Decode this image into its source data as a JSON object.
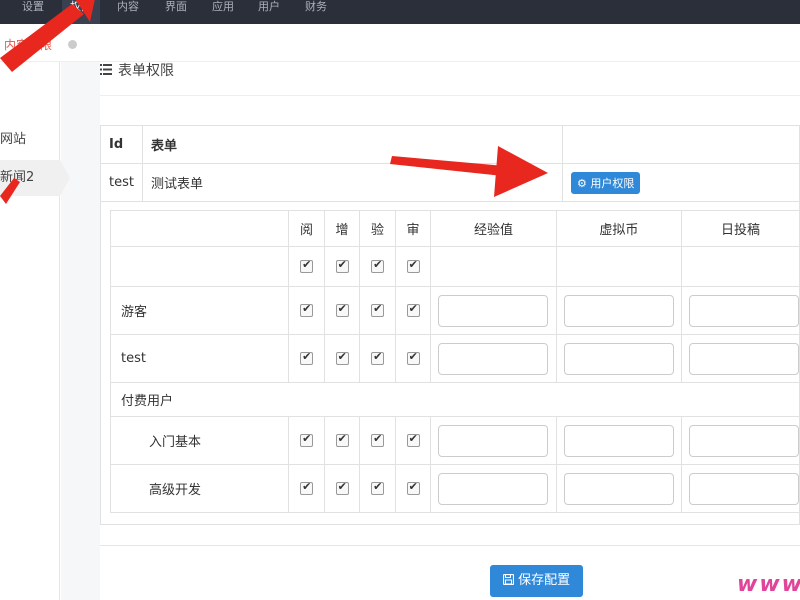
{
  "topnav": {
    "items": [
      {
        "label": "设置",
        "active": false
      },
      {
        "label": "权限",
        "active": true
      },
      {
        "label": "内容",
        "active": false
      },
      {
        "label": "界面",
        "active": false
      },
      {
        "label": "应用",
        "active": false
      },
      {
        "label": "用户",
        "active": false
      },
      {
        "label": "财务",
        "active": false
      }
    ]
  },
  "tabbar": {
    "label": "内容权限"
  },
  "sidebar": {
    "items": [
      {
        "label": "网站",
        "active": false
      },
      {
        "label": "新闻2",
        "active": true
      }
    ]
  },
  "section": {
    "title": "表单权限",
    "icon": "list-icon"
  },
  "form_table": {
    "headers": [
      "Id",
      "表单"
    ],
    "rows": [
      {
        "id": "test",
        "name": "测试表单",
        "button": "用户权限"
      }
    ]
  },
  "perm_table": {
    "columns": [
      "阅",
      "增",
      "验",
      "审",
      "经验值",
      "虚拟币",
      "日投稿"
    ],
    "rows": [
      {
        "label": "游客"
      },
      {
        "label": "test"
      }
    ],
    "group": {
      "label": "付费用户"
    },
    "sub_rows": [
      {
        "label": "入门基本"
      },
      {
        "label": "高级开发"
      }
    ]
  },
  "save_button": {
    "label": "保存配置",
    "icon": "save-icon"
  },
  "watermark": "www",
  "colors": {
    "accent": "#2f88d8",
    "nav_bg": "#2b2f3a",
    "arrow": "#e8281e",
    "watermark": "#e0459a"
  }
}
